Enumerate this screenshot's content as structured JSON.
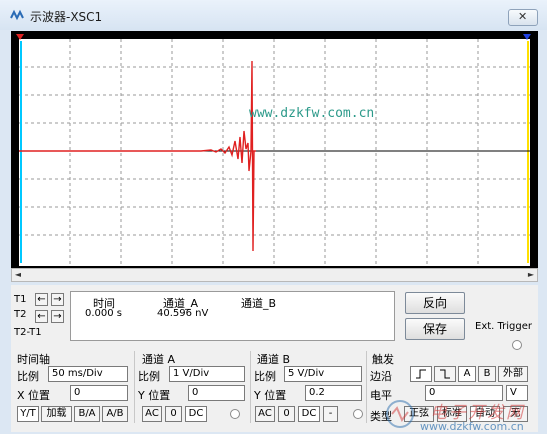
{
  "window": {
    "title": "示波器-XSC1",
    "close_symbol": "✕"
  },
  "readout": {
    "t1": "T1",
    "t2": "T2",
    "t2t1": "T2-T1",
    "col_time": "时间",
    "col_a": "通道_A",
    "col_b": "通道_B",
    "time_value": "0.000 s",
    "a_value": "40.596 nV"
  },
  "buttons": {
    "reverse": "反向",
    "save": "保存",
    "ext_trigger": "Ext. Trigger"
  },
  "timebase": {
    "title": "时间轴",
    "scale_label": "比例",
    "scale_value": "50 ms/Div",
    "pos_label": "X 位置",
    "pos_value": "0",
    "modes": [
      "Y/T",
      "加载",
      "B/A",
      "A/B"
    ]
  },
  "channel_a": {
    "title": "通道 A",
    "scale_label": "比例",
    "scale_value": "1 V/Div",
    "pos_label": "Y 位置",
    "pos_value": "0",
    "coupling": [
      "AC",
      "0",
      "DC"
    ]
  },
  "channel_b": {
    "title": "通道 B",
    "scale_label": "比例",
    "scale_value": "5 V/Div",
    "pos_label": "Y 位置",
    "pos_value": "0.2",
    "coupling": [
      "AC",
      "0",
      "DC",
      "-"
    ]
  },
  "trigger": {
    "title": "触发",
    "edge_label": "边沿",
    "edge_buttons": [
      "A",
      "B",
      "外部"
    ],
    "level_label": "电平",
    "level_value": "0",
    "level_unit": "V",
    "type_label": "类型",
    "types": [
      "正弦",
      "标准",
      "自动",
      "无"
    ]
  },
  "watermark": {
    "screen_url": "www.dzkfw.com.cn",
    "corner_url": "www.dzkfw.com.cn",
    "corner_brand": "电子开发网"
  },
  "colors": {
    "screen_bg": "#000000",
    "trace_a": "#e02020",
    "trace_b": "#000000",
    "cursor_t1": "#00c8ff",
    "cursor_t2": "#ffe000",
    "grid": "#9a9a9a"
  }
}
